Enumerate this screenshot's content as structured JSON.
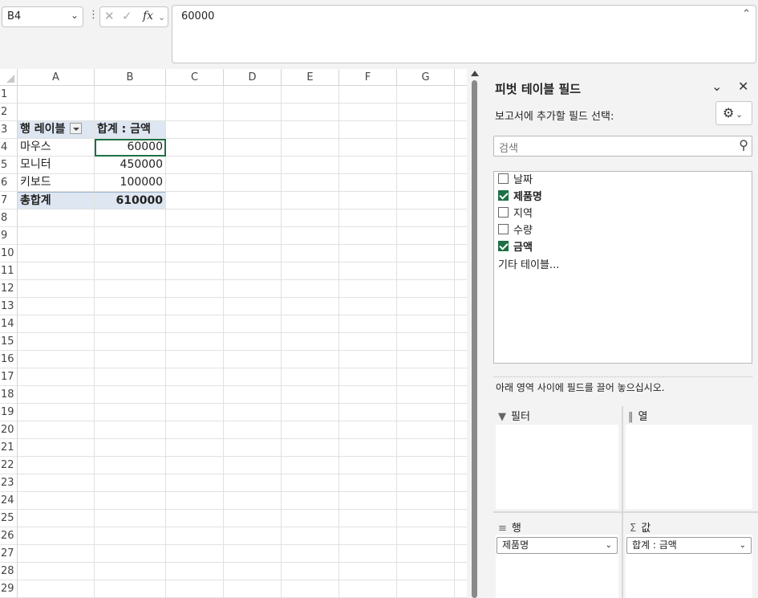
{
  "formula_bar": {
    "name_box": "B4",
    "formula_value": "60000",
    "fx_label": "fx"
  },
  "grid": {
    "columns": [
      "A",
      "B",
      "C",
      "D",
      "E",
      "F",
      "G"
    ],
    "rows": [
      "1",
      "2",
      "3",
      "4",
      "5",
      "6",
      "7",
      "8",
      "9",
      "10",
      "11",
      "12",
      "13",
      "14",
      "15",
      "16",
      "17",
      "18",
      "19",
      "20",
      "21",
      "22",
      "23",
      "24",
      "25",
      "26",
      "27",
      "28",
      "29"
    ],
    "pivot": {
      "row_label_header": "행 레이블",
      "value_header": "합계 : 금액",
      "items": [
        {
          "label": "마우스",
          "value": "60000"
        },
        {
          "label": "모니터",
          "value": "450000"
        },
        {
          "label": "키보드",
          "value": "100000"
        }
      ],
      "total_label": "총합계",
      "total_value": "610000"
    }
  },
  "pivot_pane": {
    "title": "피벗 테이블 필드",
    "subtitle": "보고서에 추가할 필드 선택:",
    "search_placeholder": "검색",
    "fields": [
      {
        "label": "날짜",
        "checked": false
      },
      {
        "label": "제품명",
        "checked": true
      },
      {
        "label": "지역",
        "checked": false
      },
      {
        "label": "수량",
        "checked": false
      },
      {
        "label": "금액",
        "checked": true
      }
    ],
    "more_tables": "기타 테이블...",
    "drag_note": "아래 영역 사이에 필드를 끌어 놓으십시오.",
    "areas": {
      "filter": "필터",
      "columns": "열",
      "rows": "행",
      "values": "값",
      "rows_item": "제품명",
      "values_item": "합계 : 금액"
    },
    "accent_color": "#1e7145"
  }
}
